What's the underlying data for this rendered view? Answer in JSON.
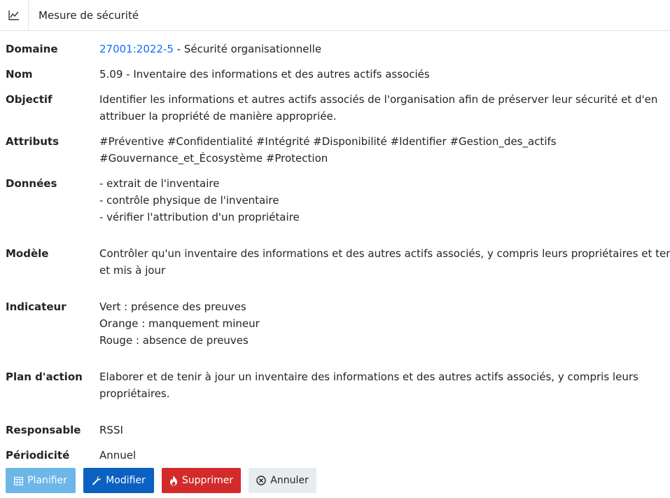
{
  "header": {
    "title": "Mesure de sécurité",
    "icon": "chart-line-icon"
  },
  "fields": {
    "domaine": {
      "label": "Domaine",
      "link": "27001:2022-5",
      "text": " - Sécurité organisationnelle"
    },
    "nom": {
      "label": "Nom",
      "value": "5.09 - Inventaire des informations et des autres actifs associés"
    },
    "objectif": {
      "label": "Objectif",
      "lines": [
        "Identifier les informations et autres actifs associés de l'organisation afin de préserver leur sécurité et d'en",
        "attribuer la propriété de manière appropriée."
      ]
    },
    "attributs": {
      "label": "Attributs",
      "lines": [
        "#Préventive #Confidentialité #Intégrité #Disponibilité #Identifier #Gestion_des_actifs",
        "#Gouvernance_et_Écosystème #Protection"
      ]
    },
    "donnees": {
      "label": "Données",
      "lines": [
        "- extrait de l'inventaire",
        "- contrôle physique de l'inventaire",
        "- vérifier l'attribution d'un propriétaire"
      ]
    },
    "modele": {
      "label": "Modèle",
      "lines": [
        "Contrôler qu'un inventaire des informations et des autres actifs associés, y compris leurs propriétaires et tenu",
        "et mis à jour"
      ]
    },
    "indicateur": {
      "label": "Indicateur",
      "lines": [
        "Vert : présence des preuves",
        "Orange : manquement mineur",
        "Rouge : absence de preuves"
      ]
    },
    "plan": {
      "label": "Plan d'action",
      "lines": [
        "Elaborer et de tenir à jour un inventaire des informations et des autres actifs associés, y compris leurs",
        "propriétaires."
      ]
    },
    "responsable": {
      "label": "Responsable",
      "value": "RSSI"
    },
    "periodicite": {
      "label": "Périodicité",
      "value": "Annuel"
    }
  },
  "buttons": {
    "planifier": {
      "label": "Planifier",
      "icon": "calendar-icon",
      "color": "#6cb6e8"
    },
    "modifier": {
      "label": "Modifier",
      "icon": "wrench-icon",
      "color": "#0b61c2"
    },
    "supprimer": {
      "label": "Supprimer",
      "icon": "fire-icon",
      "color": "#d32b2b"
    },
    "annuler": {
      "label": "Annuler",
      "icon": "cancel-circle-icon",
      "color": "#e9ecef"
    }
  }
}
